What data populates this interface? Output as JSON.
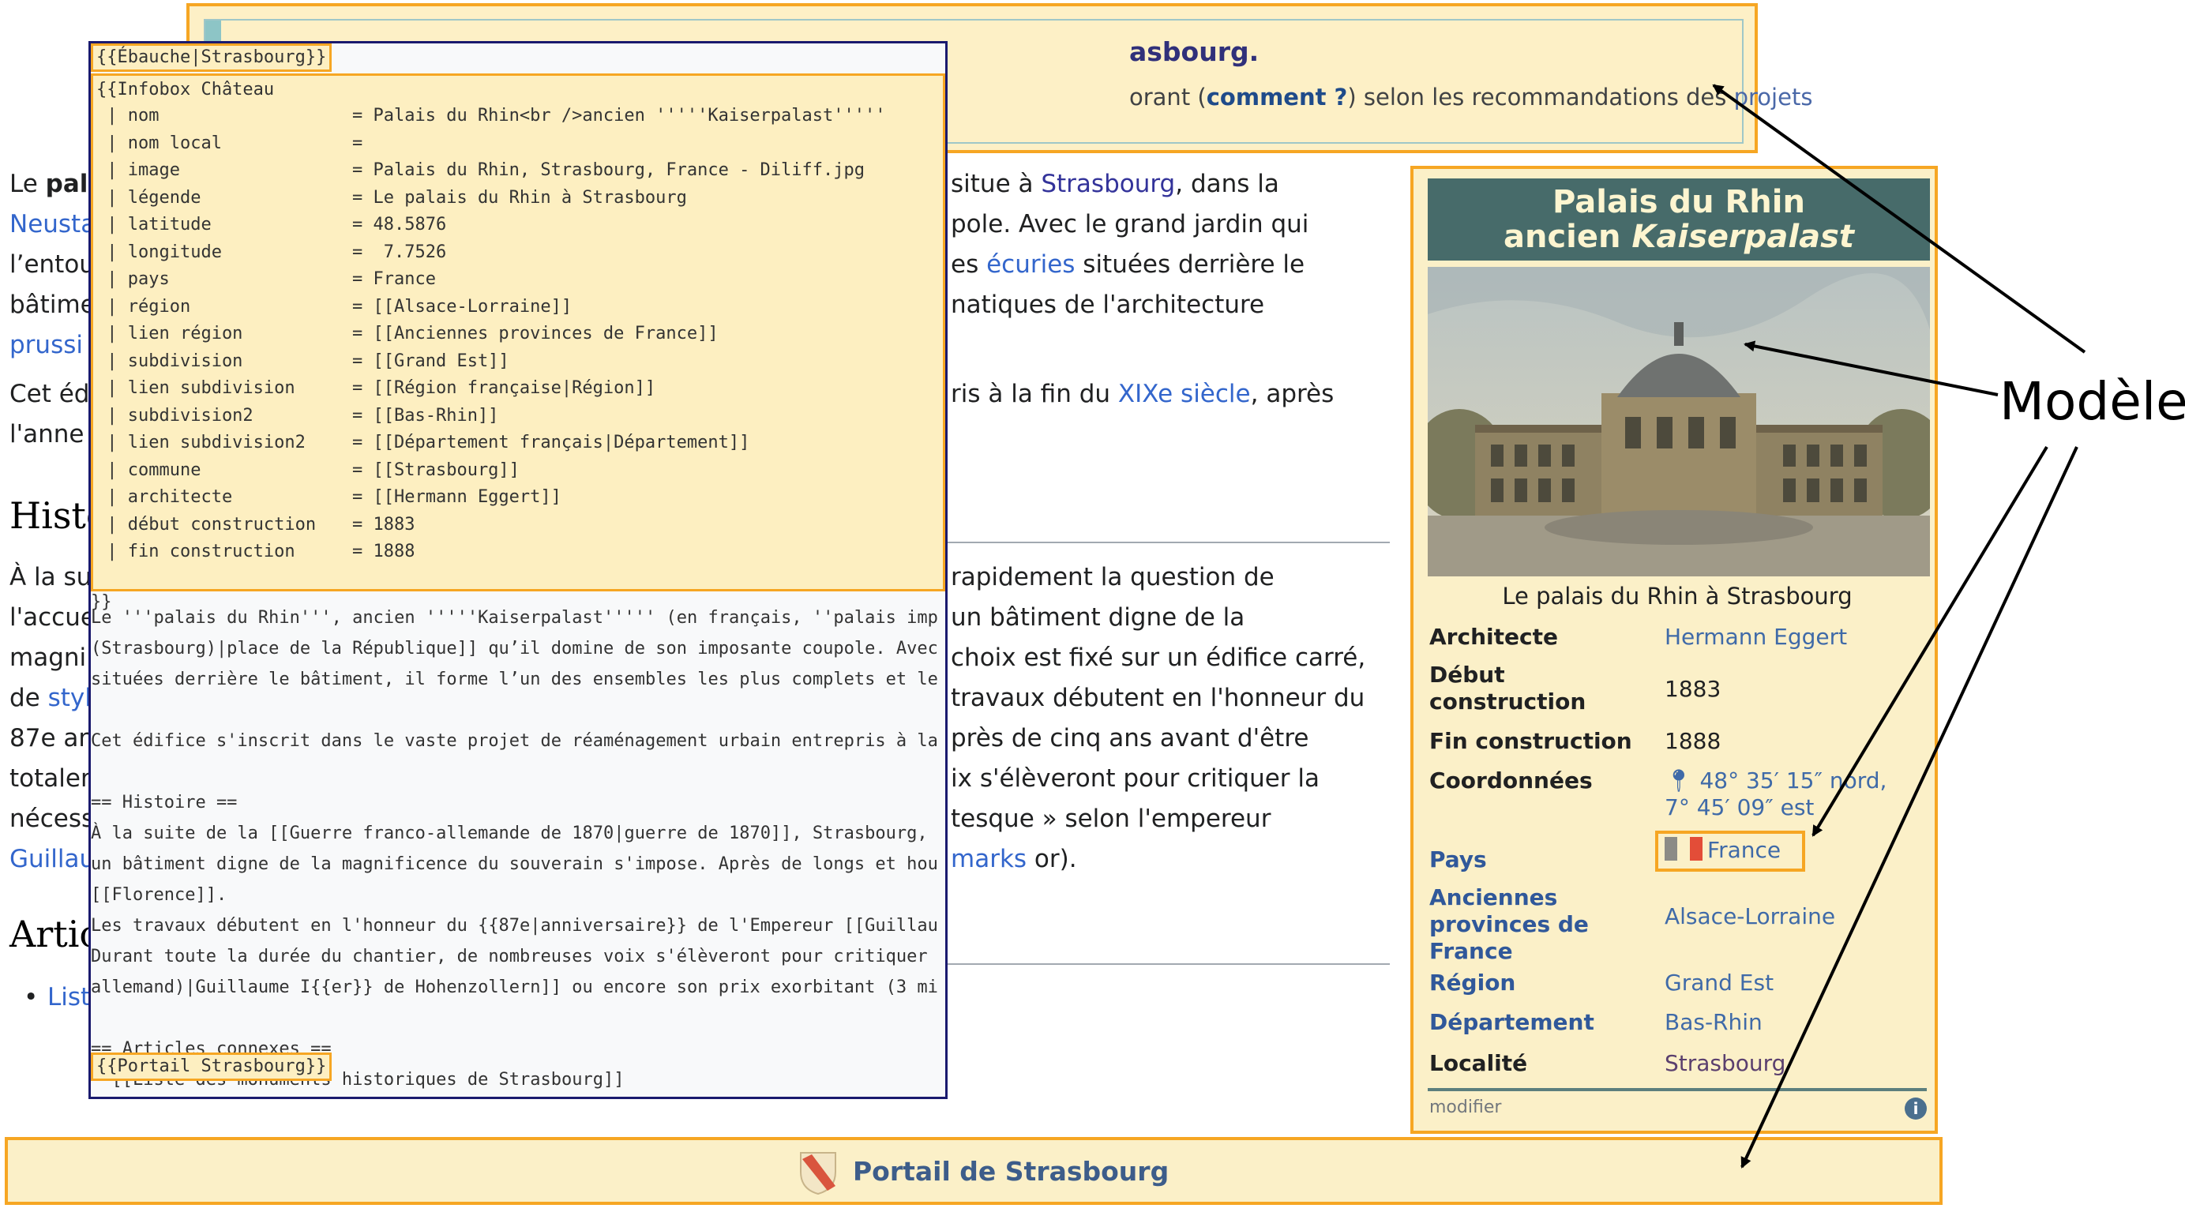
{
  "banner": {
    "title": "asbourg.",
    "text_prefix": "orant (",
    "comment_link": "comment ?",
    "text_middle": ") selon les recommandations des ",
    "projects_link": "projets"
  },
  "article": {
    "p1": [
      {
        "pre": "Le ",
        "bold": "pal"
      },
      {
        "link": "Neusta"
      },
      {
        "text": "l’entou"
      },
      {
        "text": "bâtime"
      },
      {
        "link": "prussi"
      }
    ],
    "p1_right": [
      {
        "pre": "situe à ",
        "link": "Strasbourg",
        "post": ", dans la"
      },
      {
        "pre": "pole. Avec le grand jardin qui"
      },
      {
        "pre": "es ",
        "link": "écuries",
        "post": " situées derrière le"
      },
      {
        "pre": "natiques de l'architecture"
      }
    ],
    "p2_left": [
      "Cet éd",
      "l'anne"
    ],
    "p2_right": {
      "pre": "ris à la fin du ",
      "link": "XIXe siècle",
      "post": ", après"
    },
    "h_histoire": "Histo",
    "p3_left": [
      "À la su",
      "l'accue",
      "magni",
      "de ",
      "87e an",
      "totaler",
      "nécess",
      "Guillau"
    ],
    "p3_left_link": "styl",
    "p3_right": [
      {
        "text": "rapidement la question de"
      },
      {
        "text": "un bâtiment digne de la"
      },
      {
        "text": "choix est fixé sur un édifice carré,"
      },
      {
        "text": "travaux débutent en l'honneur du"
      },
      {
        "text": "près de cinq ans avant d'être"
      },
      {
        "text": "ix s'élèveront pour critiquer la"
      },
      {
        "text": "tesque » selon l'empereur"
      },
      {
        "link": "marks",
        "post": " or)."
      }
    ],
    "h_articles": "Artic",
    "list_item": "List"
  },
  "code": {
    "ebauche": "{{Ébauche|Strasbourg}}",
    "infobox_open": "{{Infobox Château",
    "fields": [
      {
        "k": " | nom",
        "v": "= Palais du Rhin<br />ancien '''''Kaiserpalast'''''"
      },
      {
        "k": " | nom local",
        "v": "="
      },
      {
        "k": " | image",
        "v": "= Palais du Rhin, Strasbourg, France - Diliff.jpg"
      },
      {
        "k": " | légende",
        "v": "= Le palais du Rhin à Strasbourg"
      },
      {
        "k": " | latitude",
        "v": "= 48.5876"
      },
      {
        "k": " | longitude",
        "v": "=  7.7526"
      },
      {
        "k": " | pays",
        "v": "= France"
      },
      {
        "k": " | région",
        "v": "= [[Alsace-Lorraine]]"
      },
      {
        "k": " | lien région",
        "v": "= [[Anciennes provinces de France]]"
      },
      {
        "k": " | subdivision",
        "v": "= [[Grand Est]]"
      },
      {
        "k": " | lien subdivision",
        "v": "= [[Région française|Région]]"
      },
      {
        "k": " | subdivision2",
        "v": "= [[Bas-Rhin]]"
      },
      {
        "k": " | lien subdivision2",
        "v": "= [[Département français|Département]]"
      },
      {
        "k": " | commune",
        "v": "= [[Strasbourg]]"
      },
      {
        "k": " | architecte",
        "v": "= [[Hermann Eggert]]"
      },
      {
        "k": " | début construction",
        "v": "= 1883"
      },
      {
        "k": " | fin construction",
        "v": "= 1888"
      }
    ],
    "infobox_close": "}}",
    "body_lines": [
      "Le '''palais du Rhin''', ancien '''''Kaiserpalast''''' (en français, ''palais imp",
      "(Strasbourg)|place de la République]] qu’il domine de son imposante coupole. Avec",
      "situées derrière le bâtiment, il forme l’un des ensembles les plus complets et le",
      "",
      "Cet édifice s'inscrit dans le vaste projet de réaménagement urbain entrepris à la",
      "",
      "== Histoire ==",
      "À la suite de la [[Guerre franco-allemande de 1870|guerre de 1870]], Strasbourg,",
      "un bâtiment digne de la magnificence du souverain s'impose. Après de longs et hou",
      "[[Florence]].",
      "Les travaux débutent en l'honneur du {{87e|anniversaire}} de l'Empereur [[Guillau",
      "Durant toute la durée du chantier, de nombreuses voix s'élèveront pour critiquer",
      "allemand)|Guillaume I{{er}} de Hohenzollern]] ou encore son prix exorbitant (3 mi",
      "",
      "== Articles connexes ==",
      "* [[Liste des monuments historiques de Strasbourg]]"
    ],
    "portail": "{{Portail Strasbourg}}"
  },
  "infobox": {
    "title_line1": "Palais du Rhin",
    "title_line2_pre": "ancien ",
    "title_line2_italic": "Kaiserpalast",
    "caption": "Le palais du Rhin à Strasbourg",
    "rows": [
      {
        "label": "Architecte",
        "value": "Hermann Eggert",
        "value_link": true
      },
      {
        "label": "Début construction",
        "value": "1883"
      },
      {
        "label": "Fin construction",
        "value": "1888"
      },
      {
        "label": "Coordonnées",
        "value": "48° 35′ 15″ nord, 7° 45′ 09″ est",
        "value_link": true
      },
      {
        "label": "Pays",
        "value": "France",
        "label_link": true,
        "value_link": true
      },
      {
        "label": "Anciennes provinces de France",
        "value": "Alsace-Lorraine",
        "label_link": true,
        "value_link": true
      },
      {
        "label": "Région",
        "value": "Grand Est",
        "label_link": true,
        "value_link": true
      },
      {
        "label": "Département",
        "value": "Bas-Rhin",
        "label_link": true,
        "value_link": true
      },
      {
        "label": "Localité",
        "value": "Strasbourg",
        "value_link": true
      }
    ],
    "modifier": "modifier",
    "info_glyph": "i"
  },
  "portal": {
    "label": "Portail de Strasbourg"
  },
  "annotation": {
    "label": "Modèle"
  },
  "colors": {
    "accent_border": "#f6a623",
    "template_bg": "#fbf0c8",
    "link": "#3366cc",
    "infobox_header": "#476b6a"
  }
}
